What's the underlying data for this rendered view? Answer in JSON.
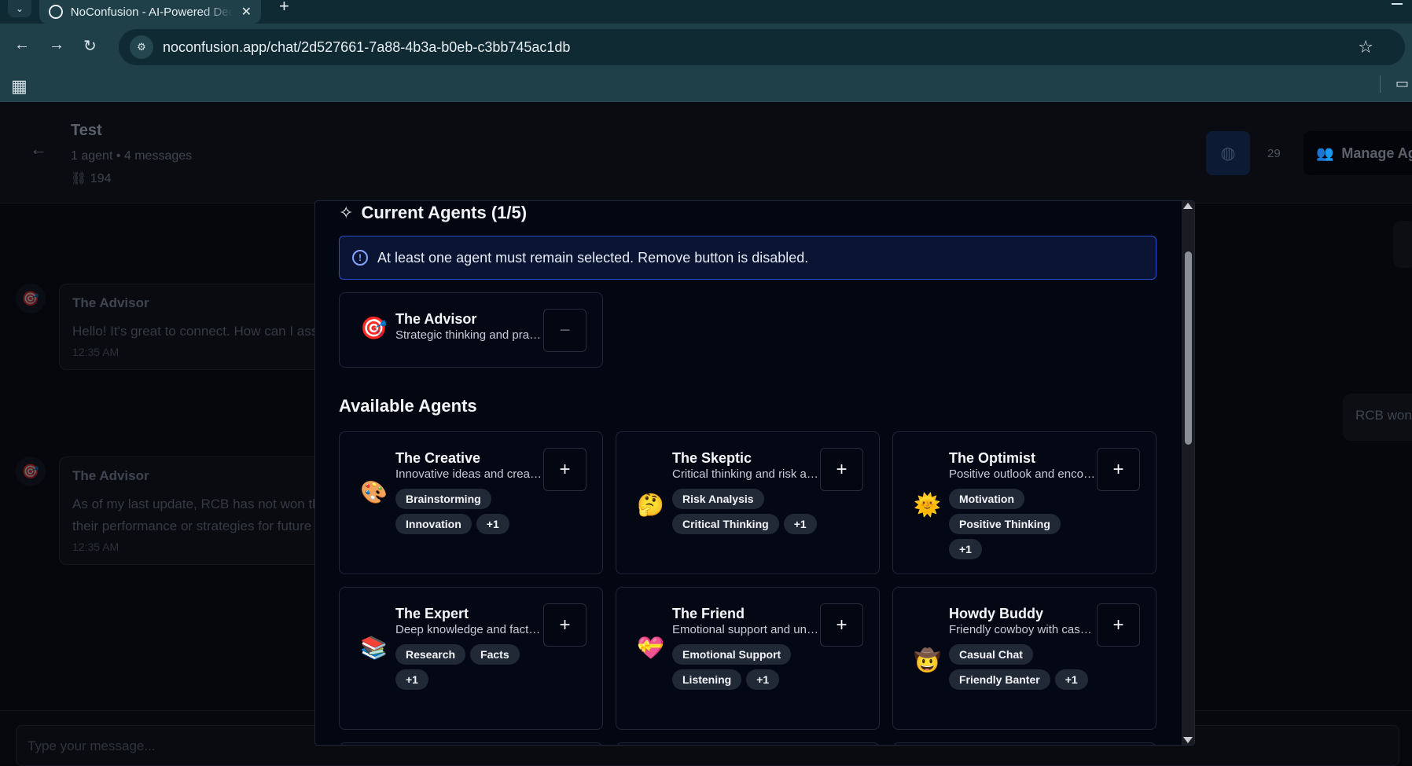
{
  "browser": {
    "tab_title": "NoConfusion - AI-Powered Decision",
    "url": "noconfusion.app/chat/2d527661-7a88-4b3a-b0eb-c3bb745ac1db",
    "icons": {
      "back": "←",
      "forward": "→",
      "reload": "↻",
      "star": "☆",
      "new_tab": "+",
      "close": "✕",
      "apps": "▦",
      "folder": "▭",
      "tab_menu": "⌄",
      "site_info": "⚙"
    }
  },
  "app": {
    "chat_title": "Test",
    "chat_meta": "1 agent • 4 messages",
    "chat_count": "194",
    "credits": "29",
    "manage_label": "Manage Agents",
    "messages": [
      {
        "author": "The Advisor",
        "text": "Hello! It's great to connect. How can I assist you today?",
        "time": "12:35 AM"
      },
      {
        "author": "The Advisor",
        "text": "As of my last update, RCB has not won the IPL title.",
        "text2": "their performance or strategies for future seasons?",
        "time": "12:35 AM"
      }
    ],
    "user_bubble": "RCB won",
    "composer_placeholder": "Type your message..."
  },
  "modal": {
    "current_title": "Current Agents (1/5)",
    "info_text": "At least one agent must remain selected. Remove button is disabled.",
    "current_agents": [
      {
        "emoji": "🎯",
        "name": "The Advisor",
        "desc": "Strategic thinking and practical advice",
        "button": "−"
      }
    ],
    "available_title": "Available Agents",
    "available_agents": [
      {
        "emoji": "🎨",
        "name": "The Creative",
        "desc": "Innovative ideas and creative solutions",
        "tags": [
          "Brainstorming",
          "Innovation",
          "+1"
        ],
        "button": "+"
      },
      {
        "emoji": "🤔",
        "name": "The Skeptic",
        "desc": "Critical thinking and risk assessment",
        "tags": [
          "Risk Analysis",
          "Critical Thinking",
          "+1"
        ],
        "button": "+"
      },
      {
        "emoji": "🌞",
        "name": "The Optimist",
        "desc": "Positive outlook and encouragement",
        "tags": [
          "Motivation",
          "Positive Thinking",
          "+1"
        ],
        "button": "+"
      },
      {
        "emoji": "📚",
        "name": "The Expert",
        "desc": "Deep knowledge and factual insights",
        "tags": [
          "Research",
          "Facts",
          "+1"
        ],
        "button": "+"
      },
      {
        "emoji": "💝",
        "name": "The Friend",
        "desc": "Emotional support and understanding",
        "tags": [
          "Emotional Support",
          "Listening",
          "+1"
        ],
        "button": "+"
      },
      {
        "emoji": "🤠",
        "name": "Howdy Buddy",
        "desc": "Friendly cowboy with casual charm",
        "tags": [
          "Casual Chat",
          "Friendly Banter",
          "+1"
        ],
        "button": "+"
      }
    ]
  }
}
